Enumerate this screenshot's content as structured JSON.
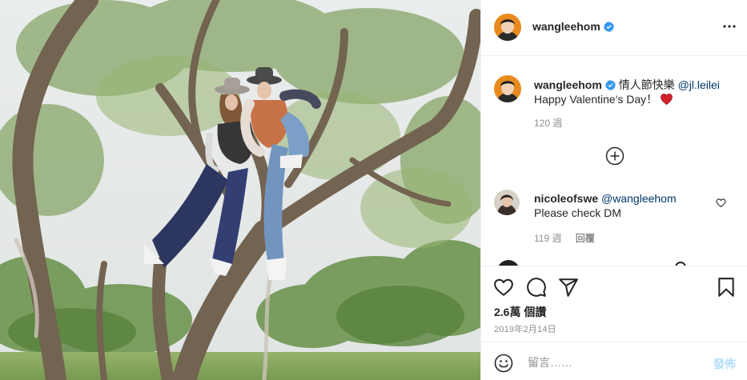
{
  "post": {
    "username": "wangleehom",
    "verified": true
  },
  "caption": {
    "username": "wangleehom",
    "text": "情人節快樂",
    "mention": "@jl.leilei",
    "line2": "Happy Valentine's Day！",
    "emoji": "red-heart",
    "time": "120 週"
  },
  "comments": [
    {
      "username": "nicoleofswe",
      "mention": "@wangleehom",
      "text": "Please check DM",
      "time": "119 週",
      "reply_label": "回覆"
    }
  ],
  "stats": {
    "views": "2.6萬 個讚",
    "date": "2019年2月14日"
  },
  "composer": {
    "placeholder": "留言……",
    "post_label": "發佈"
  },
  "icons": {
    "header_more": "more-horizontal-icon",
    "load_more": "plus-circle-icon",
    "like": "heart-outline-icon",
    "comment": "comment-bubble-icon",
    "share": "paper-plane-icon",
    "save": "bookmark-icon",
    "emoji": "smiley-icon"
  },
  "colors": {
    "verified": "#3897f0",
    "mention": "#00376b",
    "secondary": "#8e8e8e",
    "post_disabled": "#b2dffc",
    "heart_red": "#d3202d"
  }
}
